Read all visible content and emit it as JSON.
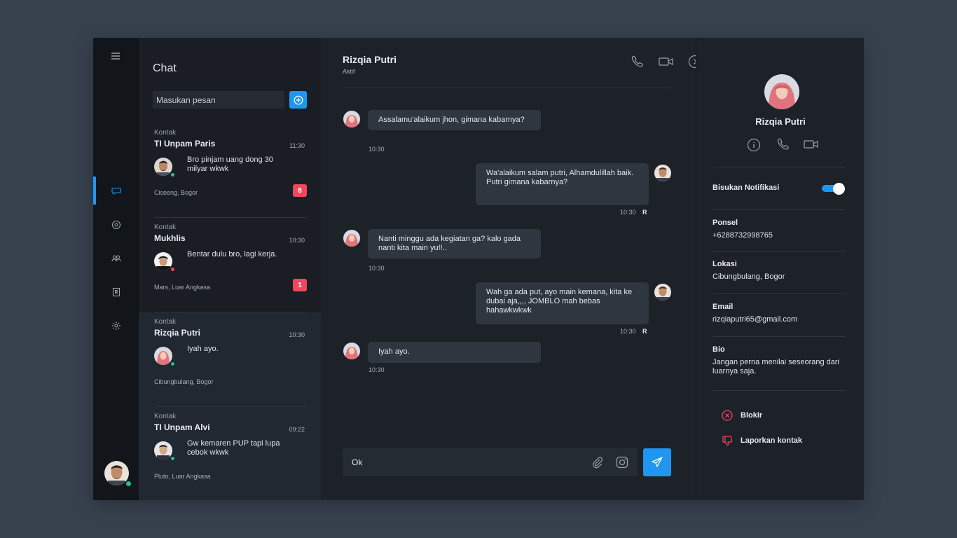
{
  "rail": {
    "menu_icon": "hamburger-icon",
    "items": [
      {
        "icon": "chat-bubble-icon",
        "active": true
      },
      {
        "icon": "status-icon",
        "active": false
      },
      {
        "icon": "group-icon",
        "active": false
      },
      {
        "icon": "contacts-book-icon",
        "active": false
      },
      {
        "icon": "gear-icon",
        "active": false
      }
    ]
  },
  "list": {
    "title": "Chat",
    "search_placeholder": "Masukan pesan",
    "contacts": [
      {
        "tag": "Kontak",
        "name": "TI Unpam Paris",
        "time": "11:30",
        "message": "Bro pinjam uang dong 30 milyar wkwk",
        "location": "Ciseeng, Bogor",
        "badge": "8",
        "status_color": "#1ec28b"
      },
      {
        "tag": "Kontak",
        "name": "Mukhlis",
        "time": "10:30",
        "message": "Bentar dulu bro, lagi kerja.",
        "location": "Mars, Luar Angkasa",
        "badge": "1",
        "status_color": "#f0475e"
      },
      {
        "tag": "Kontak",
        "name": "Rizqia Putri",
        "time": "10:30",
        "message": "Iyah ayo.",
        "location": "Cibungbulang, Bogor",
        "badge": "",
        "status_color": "#1ec28b"
      },
      {
        "tag": "Kontak",
        "name": "TI Unpam Alvi",
        "time": "09:22",
        "message": "Gw kemaren PUP tapi lupa cebok wkwk",
        "location": "Pluto, Luar Angkasa",
        "badge": "",
        "status_color": "#1ec28b"
      }
    ]
  },
  "conversation": {
    "name": "Rizqia Putri",
    "status": "Aktif",
    "messages": [
      {
        "from": "them",
        "text": "Assalamu'alaikum jhon, gimana kabarnya?",
        "time": "10:30",
        "read": ""
      },
      {
        "from": "me",
        "text": "Wa'alaikum salam putri, Alhamdulillah baik. Putri gimana kabarnya?",
        "time": "10:30",
        "read": "R"
      },
      {
        "from": "them",
        "text": "Nanti minggu ada kegiatan ga? kalo gada nanti kita main yu!!..",
        "time": "10:30",
        "read": ""
      },
      {
        "from": "me",
        "text": "Wah ga ada put, ayo main kemana, kita ke dubai aja,,,, JOMBLO mah bebas hahawkwkwk",
        "time": "10:30",
        "read": "R"
      },
      {
        "from": "them",
        "text": "Iyah ayo.",
        "time": "10:30",
        "read": ""
      }
    ],
    "composer_value": "Ok"
  },
  "profile": {
    "name": "Rizqia Putri",
    "mute_label": "Bisukan Notifikasi",
    "mute_on": true,
    "phone_label": "Ponsel",
    "phone": "+6288732998765",
    "location_label": "Lokasi",
    "location": "Cibungbulang, Bogor",
    "email_label": "Email",
    "email": "rizqiaputri65@gmail.com",
    "bio_label": "Bio",
    "bio": "Jangan perna menilai seseorang dari luarnya saja.",
    "block_label": "Blokir",
    "report_label": "Laporkan kontak"
  },
  "colors": {
    "accent": "#1f96ef",
    "danger": "#f0475e",
    "online": "#1ec28b"
  }
}
